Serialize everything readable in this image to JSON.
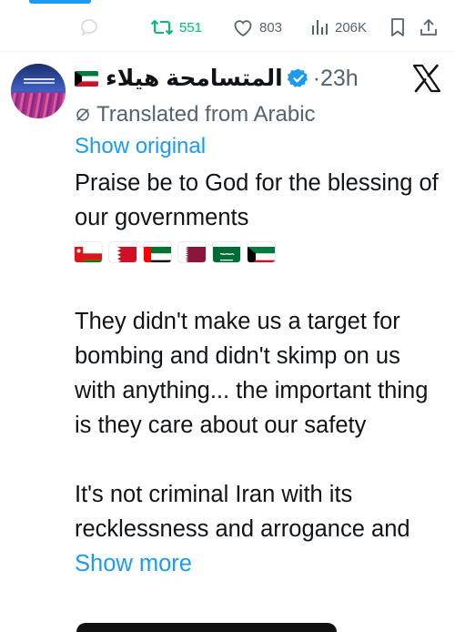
{
  "action_bar": {
    "retweet_count": "551",
    "like_count": "803",
    "view_count": "206K",
    "icons": [
      "reply-icon",
      "retweet-icon",
      "heart-icon",
      "views-icon",
      "bookmark-icon",
      "share-icon"
    ]
  },
  "tweet": {
    "display_name": "المتسامحة هيلاء",
    "name_flag": "flag-kuwait",
    "verified": true,
    "time": "23h",
    "platform_logo": "x-logo-icon",
    "translated_label": "Translated from Arabic",
    "show_original_label": "Show original",
    "paragraph_1": "Praise be to God for the blessing of our governments",
    "flags": [
      "flag-oman",
      "flag-bahrain",
      "flag-uae",
      "flag-qatar",
      "flag-saudi-arabia",
      "flag-kuwait"
    ],
    "paragraph_2": "They didn't make us a target for bombing and didn't skimp on us with anything... the important thing is they care about our safety",
    "paragraph_3": "It's not criminal Iran with its recklessness and arrogance and",
    "show_more_label": "Show more"
  },
  "colors": {
    "link": "#1d9bf0",
    "secondary_text": "#536471",
    "retweet_green": "#00ba7c",
    "text": "#0f1419"
  }
}
